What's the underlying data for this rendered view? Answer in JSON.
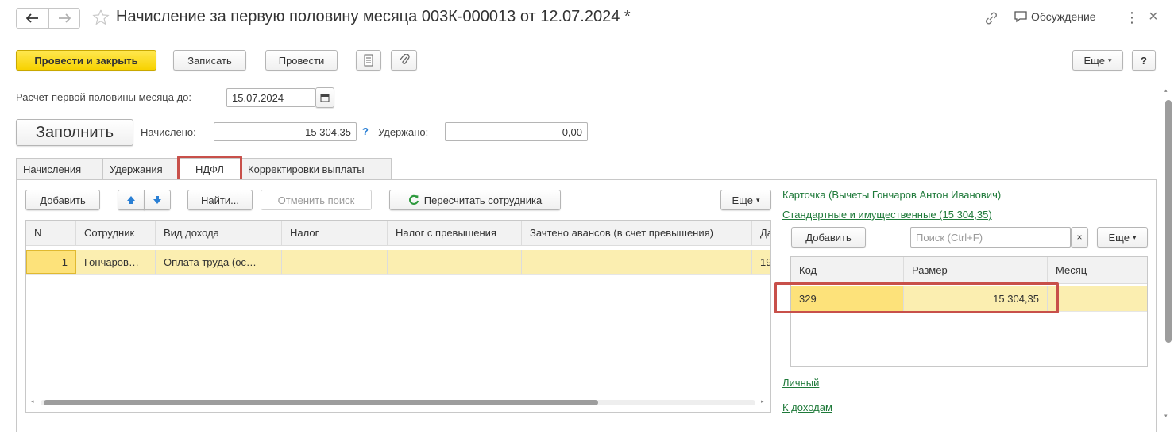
{
  "window": {
    "title": "Начисление за первую половину месяца 003К-000013 от 12.07.2024 *",
    "discussion_label": "Обсуждение"
  },
  "toolbar": {
    "post_close": "Провести и закрыть",
    "save": "Записать",
    "post": "Провести",
    "more": "Еще",
    "help": "?"
  },
  "calc": {
    "label": "Расчет первой половины месяца до:",
    "date": "15.07.2024"
  },
  "summary": {
    "fill": "Заполнить",
    "accrued_label": "Начислено:",
    "accrued_value": "15 304,35",
    "question": "?",
    "withheld_label": "Удержано:",
    "withheld_value": "0,00"
  },
  "tabs": [
    {
      "label": "Начисления"
    },
    {
      "label": "Удержания"
    },
    {
      "label": "НДФЛ"
    },
    {
      "label": "Корректировки выплаты"
    }
  ],
  "ndfl_toolbar": {
    "add": "Добавить",
    "find": "Найти...",
    "cancel_search": "Отменить поиск",
    "recalc": "Пересчитать сотрудника",
    "more": "Еще"
  },
  "ndfl_table": {
    "headers": [
      "N",
      "Сотрудник",
      "Вид дохода",
      "Налог",
      "Налог с превышения",
      "Зачтено авансов (в счет превышения)",
      "Да"
    ],
    "rows": [
      {
        "n": "1",
        "employee": "Гончаров…",
        "income": "Оплата труда (ос…",
        "tax": "",
        "tax_excess": "",
        "advance": "",
        "date": "19"
      }
    ]
  },
  "right_panel": {
    "card": "Карточка (Вычеты Гончаров Антон Иванович)",
    "standard_link": "Стандартные и имущественные (15 304,35)",
    "add": "Добавить",
    "search_placeholder": "Поиск (Ctrl+F)",
    "clear": "×",
    "more": "Еще",
    "headers": [
      "Код",
      "Размер",
      "Месяц"
    ],
    "rows": [
      {
        "code": "329",
        "amount": "15 304,35",
        "month": ""
      }
    ],
    "personal_link": "Личный",
    "income_link": "К доходам"
  },
  "colors": {
    "accent_yellow": "#f7d200",
    "link_green": "#1f7a3a",
    "highlight_row": "#fbeeb0",
    "red_frame": "#c8504a"
  }
}
